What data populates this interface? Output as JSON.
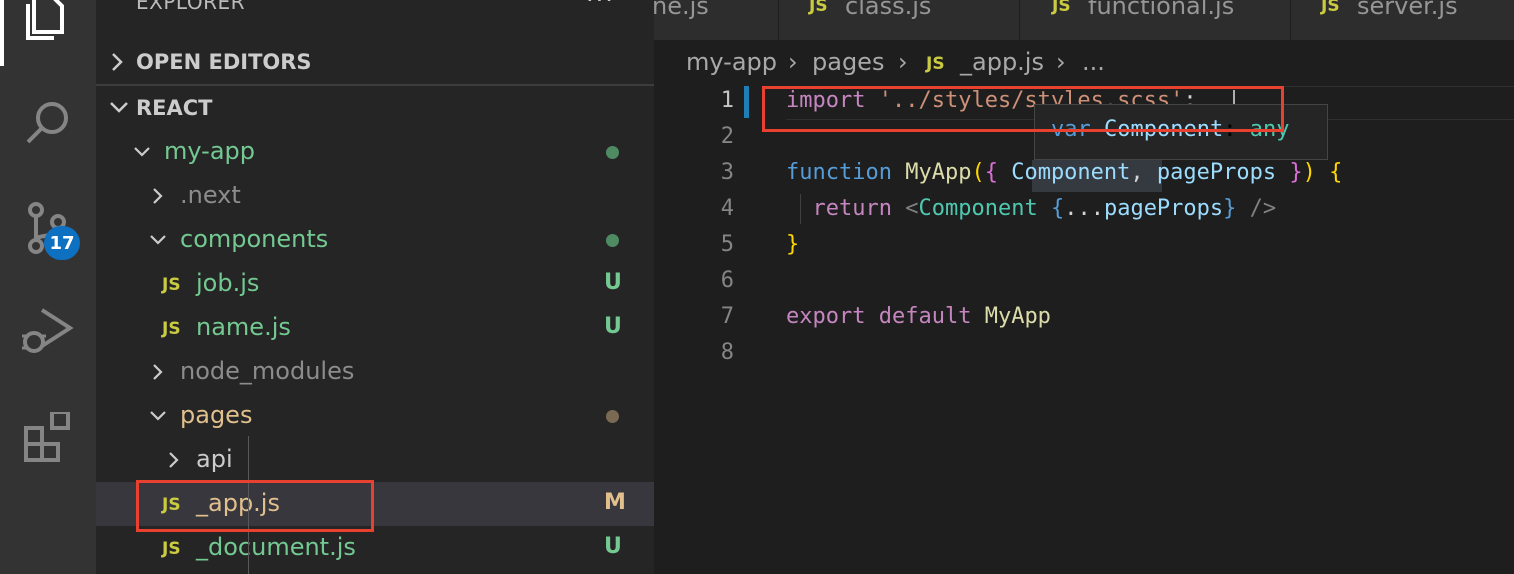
{
  "activity_bar": {
    "scm_badge": "17"
  },
  "sidebar": {
    "header": "EXPLORER",
    "more": "···",
    "sections": {
      "open_editors": "OPEN EDITORS",
      "workspace": "REACT"
    },
    "tree": [
      {
        "label": "my-app",
        "type": "folder",
        "expanded": true,
        "status": "dot",
        "color": "#73c991"
      },
      {
        "label": ".next",
        "type": "folder",
        "expanded": false,
        "status": "",
        "color": "#8c8c8c"
      },
      {
        "label": "components",
        "type": "folder",
        "expanded": true,
        "status": "dot",
        "color": "#73c991"
      },
      {
        "label": "job.js",
        "type": "file",
        "status": "U",
        "color": "#73c991"
      },
      {
        "label": "name.js",
        "type": "file",
        "status": "U",
        "color": "#73c991"
      },
      {
        "label": "node_modules",
        "type": "folder",
        "expanded": false,
        "status": "",
        "color": "#8c8c8c"
      },
      {
        "label": "pages",
        "type": "folder",
        "expanded": true,
        "status": "dot",
        "color": "#e2c08d"
      },
      {
        "label": "api",
        "type": "folder",
        "expanded": false,
        "status": "",
        "color": "#cccccc"
      },
      {
        "label": "_app.js",
        "type": "file",
        "status": "M",
        "color": "#e2c08d"
      },
      {
        "label": "_document.js",
        "type": "file",
        "status": "U",
        "color": "#73c991"
      }
    ],
    "file_icon": "JS"
  },
  "tabs": [
    {
      "label": "ne.js"
    },
    {
      "label": "class.js"
    },
    {
      "label": "functional.js"
    },
    {
      "label": "server.js"
    }
  ],
  "breadcrumb": {
    "parts": [
      "my-app",
      "pages",
      "_app.js",
      "..."
    ],
    "separator": "›"
  },
  "editor": {
    "line_numbers": [
      "1",
      "2",
      "3",
      "4",
      "5",
      "6",
      "7",
      "8"
    ],
    "line1": {
      "kw": "import",
      "str": "'../styles/styles.scss'",
      "semi": ";"
    },
    "line3": {
      "kw": "function",
      "fn": "MyApp",
      "p1": "(",
      "b1": "{",
      "v1": "Component",
      "c": ",",
      "v2": "pageProps",
      "b2": "}",
      "p2": ")",
      "b3": "{"
    },
    "line4": {
      "kw": "return",
      "lt": "<",
      "tag": "Component",
      "ob": "{",
      "spread": "...",
      "v": "pageProps",
      "cb": "}",
      "end": "/>"
    },
    "line5": {
      "b": "}"
    },
    "line7": {
      "kw1": "export",
      "kw2": "default",
      "fn": "MyApp"
    },
    "hover": {
      "kw": "var",
      "name": "Component",
      "colon": ":",
      "type": "any"
    }
  },
  "colors": {
    "annotation_box": "#e8412f",
    "accent": "#0e70c0"
  }
}
